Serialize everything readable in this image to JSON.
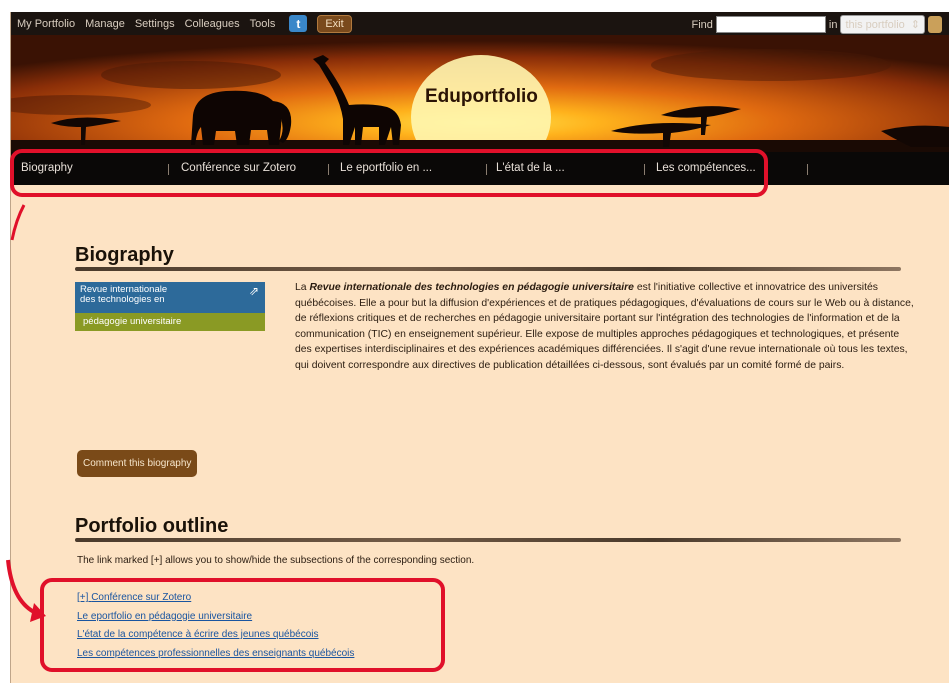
{
  "topbar": {
    "nav": [
      "My Portfolio",
      "Manage",
      "Settings",
      "Colleagues",
      "Tools"
    ],
    "twitter_icon": "t",
    "exit_label": "Exit",
    "find_label": "Find",
    "find_value": "",
    "in_label": "in",
    "scope_value": "this portfolio",
    "scope_arrow": "⇕"
  },
  "banner": {
    "title": "Eduportfolio"
  },
  "mainnav": {
    "items": [
      "Biography",
      "Conférence sur Zotero",
      "Le eportfolio en ...",
      "L'état de la ...",
      "Les compétences..."
    ]
  },
  "biography": {
    "heading": "Biography",
    "logo_line1": "Revue internationale",
    "logo_line2": "des technologies en",
    "logo_line3": "pédagogie universitaire",
    "logo_icon": "⇗",
    "text_prefix": "La ",
    "text_bold": "Revue internationale des technologies en pédagogie universitaire",
    "text_rest": " est l'initiative collective et innovatrice des universités québécoises. Elle a pour but la diffusion d'expériences et de pratiques pédagogiques, d'évaluations de cours sur le Web ou à distance, de réflexions critiques et de recherches en pédagogie universitaire portant sur l'intégration des technologies de l'information et de la communication (TIC) en enseignement supérieur. Elle expose de multiples approches pédagogiques et technologiques, et présente des expertises interdisciplinaires et des expériences académiques différenciées. Il s'agit d'une revue internationale où tous les textes, qui doivent correspondre aux directives de publication détaillées ci-dessous, sont évalués par un comité formé de pairs.",
    "comment_button": "Comment this biography"
  },
  "outline": {
    "heading": "Portfolio outline",
    "description": "The link marked [+] allows you to show/hide the subsections of the corresponding section.",
    "toggle": "[+]",
    "links": [
      "Conférence sur Zotero",
      "Le eportfolio en pédagogie universitaire",
      "L'état de la compétence à écrire des jeunes québécois",
      "Les compétences professionnelles des enseignants québécois"
    ]
  },
  "colors": {
    "highlight": "#e0102a",
    "background": "#fde3c4",
    "nav": "#0a0807"
  }
}
